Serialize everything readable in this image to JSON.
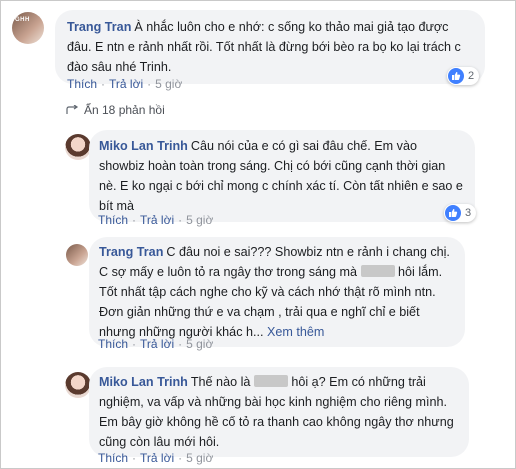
{
  "comments": [
    {
      "author": "Trang Tran",
      "text": "À nhắc luôn cho e nhớ: c sống ko thảo mai giả tạo được đâu. E ntn e rảnh nhất rồi. Tốt nhất là đừng bới bèo ra bọ ko lại trách c đào sâu nhé Trinh.",
      "reaction_count": "2"
    },
    {
      "author": "Miko Lan Trinh",
      "text": "Câu nói của e có gì sai đâu chế. Em vào showbiz hoàn toàn trong sáng. Chị có bới cũng cạnh thời gian nè. E ko ngại c bới chỉ mong c chính xác tí. Còn tất nhiên e sao e bít mà",
      "reaction_count": "3"
    },
    {
      "author": "Trang Tran",
      "text_part1": "C đâu noi e sai??? Showbiz ntn e rảnh i chang chị. C sợ mấy e luôn tỏ ra ngây thơ trong sáng mà",
      "text_part2": "hôi lắm. Tốt nhất tập cách nghe cho kỹ và cách nhớ thật rõ mình ntn. Đơn giản những thứ e va chạm , trải qua e nghĩ chỉ e biết nhưng những người khác h...",
      "see_more": "Xem thêm"
    },
    {
      "author": "Miko Lan Trinh",
      "text_part1": "Thế nào là",
      "text_part2": "hôi ạ? Em có những trải nghiệm, va vấp và những bài học kinh nghiệm cho riêng mình. Em bây giờ không hề cố tỏ ra thanh cao không ngây thơ nhưng cũng còn lâu mới hôi."
    }
  ],
  "actions": {
    "like": "Thích",
    "reply": "Trả lời",
    "time": "5 giờ"
  },
  "hidden_replies": "Ẩn 18 phản hồi",
  "avatar_label": "GHH",
  "colors": {
    "name": "#385898",
    "bubble": "#f2f3f5",
    "like": "#4080ff"
  },
  "icons": [
    "like-icon",
    "reply-arrow-icon"
  ]
}
